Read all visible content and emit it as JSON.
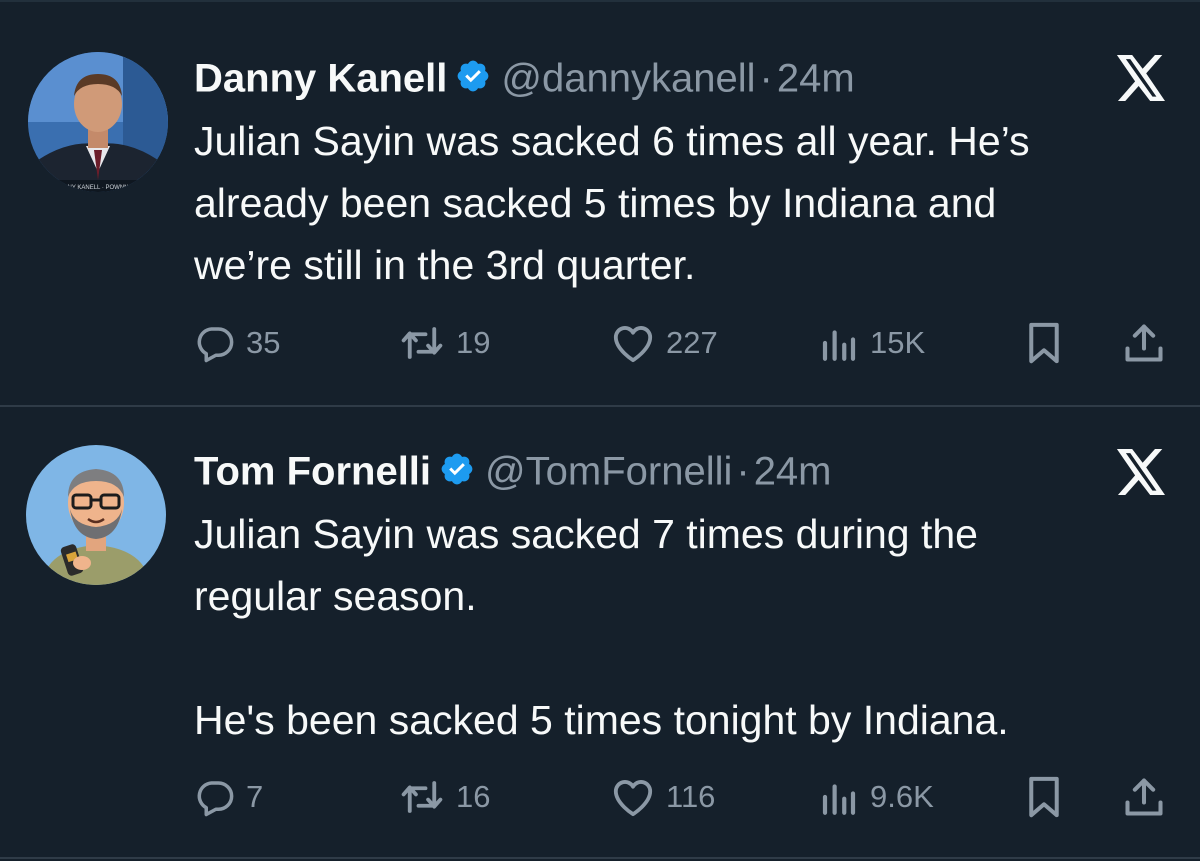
{
  "tweets": [
    {
      "author_name": "Danny Kanell",
      "handle": "@dannykanell",
      "separator": "·",
      "time": "24m",
      "avatar_caption": "NY KANELL · POWNN",
      "body": [
        "Julian Sayin was sacked 6 times all year. He’s",
        "already been sacked 5 times by Indiana and",
        "we’re still in the 3rd quarter."
      ],
      "replies": "35",
      "reposts": "19",
      "likes": "227",
      "views": "15K"
    },
    {
      "author_name": "Tom Fornelli",
      "handle": "@TomFornelli",
      "separator": "·",
      "time": "24m",
      "body": [
        "Julian Sayin was sacked 7 times during the",
        "regular season.",
        "He's been sacked 5 times tonight by Indiana."
      ],
      "replies": "7",
      "reposts": "16",
      "likes": "116",
      "views": "9.6K"
    }
  ],
  "icons": {
    "reply": "reply-icon",
    "repost": "repost-icon",
    "like": "like-icon",
    "views": "views-icon",
    "bookmark": "bookmark-icon",
    "share": "share-icon",
    "brand": "x-logo-icon",
    "verified": "verified-badge-icon"
  },
  "colors": {
    "background": "#15202b",
    "text": "#f7f9f9",
    "muted": "#8b98a5",
    "verified": "#1d9bf0",
    "divider": "#2f3b47"
  }
}
